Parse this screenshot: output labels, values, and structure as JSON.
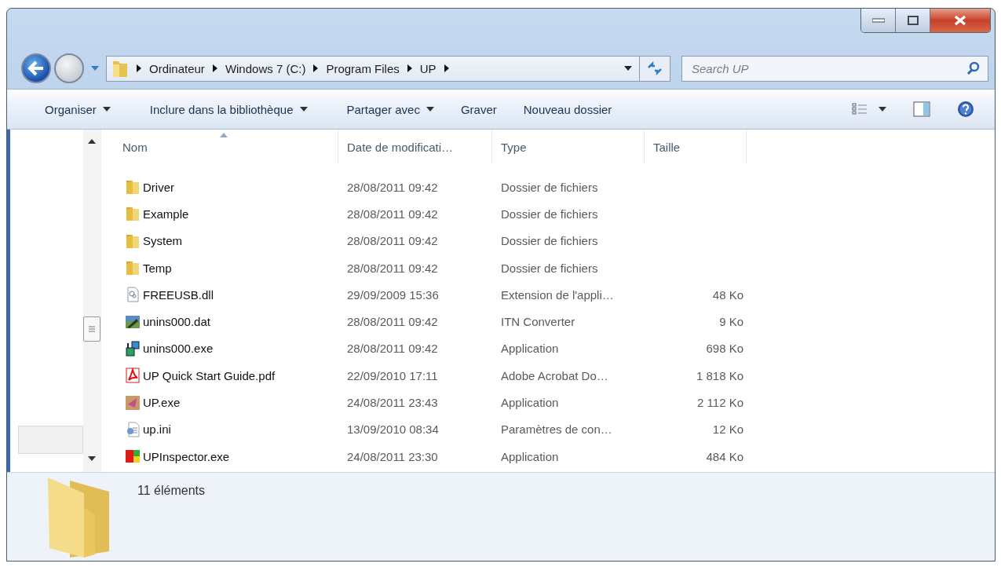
{
  "address": {
    "path": [
      "Ordinateur",
      "Windows 7 (C:)",
      "Program Files",
      "UP"
    ]
  },
  "search": {
    "placeholder": "Search UP"
  },
  "toolbar": [
    {
      "label": "Organiser",
      "dropdown": true
    },
    {
      "label": "Inclure dans la bibliothèque",
      "dropdown": true
    },
    {
      "label": "Partager avec",
      "dropdown": true
    },
    {
      "label": "Graver",
      "dropdown": false
    },
    {
      "label": "Nouveau dossier",
      "dropdown": false
    }
  ],
  "columns": [
    {
      "label": "Nom",
      "sorted": true
    },
    {
      "label": "Date de modificati…",
      "sorted": false
    },
    {
      "label": "Type",
      "sorted": false
    },
    {
      "label": "Taille",
      "sorted": false
    }
  ],
  "rows": [
    {
      "kind": "folder",
      "name": "Driver",
      "date": "28/08/2011 09:42",
      "type": "Dossier de fichiers"
    },
    {
      "kind": "folder",
      "name": "Example",
      "date": "28/08/2011 09:42",
      "type": "Dossier de fichiers"
    },
    {
      "kind": "folder",
      "name": "System",
      "date": "28/08/2011 09:42",
      "type": "Dossier de fichiers"
    },
    {
      "kind": "folder",
      "name": "Temp",
      "date": "28/08/2011 09:42",
      "type": "Dossier de fichiers"
    },
    {
      "kind": "dll",
      "name": "FREEUSB.dll",
      "date": "29/09/2009 15:36",
      "type": "Extension de l'appli…",
      "size": "48 Ko"
    },
    {
      "kind": "dat",
      "name": "unins000.dat",
      "date": "28/08/2011 09:42",
      "type": "ITN Converter",
      "size": "9 Ko"
    },
    {
      "kind": "setup",
      "name": "unins000.exe",
      "date": "28/08/2011 09:42",
      "type": "Application",
      "size": "698 Ko"
    },
    {
      "kind": "pdf",
      "name": "UP Quick Start Guide.pdf",
      "date": "22/09/2010 17:11",
      "type": "Adobe Acrobat Do…",
      "size": "1 818 Ko"
    },
    {
      "kind": "app",
      "name": "UP.exe",
      "date": "24/08/2011 23:43",
      "type": "Application",
      "size": "2 112 Ko"
    },
    {
      "kind": "ini",
      "name": "up.ini",
      "date": "13/09/2010 08:34",
      "type": "Paramètres de con…",
      "size": "12 Ko"
    },
    {
      "kind": "inspector",
      "name": "UPInspector.exe",
      "date": "24/08/2011 23:30",
      "type": "Application",
      "size": "484 Ko"
    }
  ],
  "status": {
    "count": "11 éléments"
  }
}
